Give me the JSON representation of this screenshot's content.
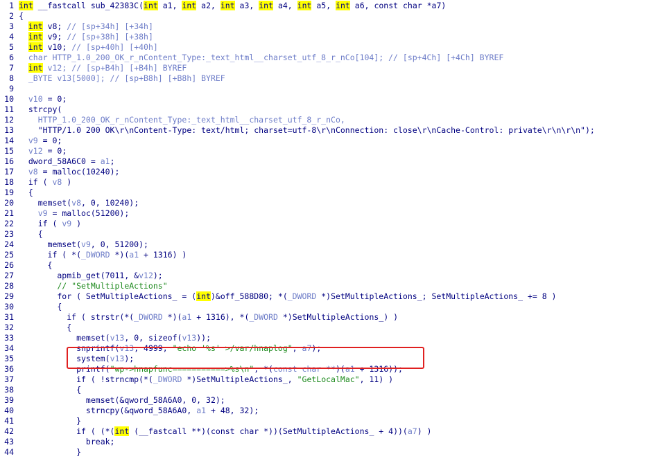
{
  "pseudocode": {
    "lines": [
      {
        "n": "1",
        "code": [
          {
            "t": "int",
            "k": "kw"
          },
          {
            "t": " __fastcall sub_42383C(",
            "k": "p"
          },
          {
            "t": "int",
            "k": "kw"
          },
          {
            "t": " a1, ",
            "k": "p"
          },
          {
            "t": "int",
            "k": "kw"
          },
          {
            "t": " a2, ",
            "k": "p"
          },
          {
            "t": "int",
            "k": "kw"
          },
          {
            "t": " a3, ",
            "k": "p"
          },
          {
            "t": "int",
            "k": "kw"
          },
          {
            "t": " a4, ",
            "k": "p"
          },
          {
            "t": "int",
            "k": "kw"
          },
          {
            "t": " a5, ",
            "k": "p"
          },
          {
            "t": "int",
            "k": "kw"
          },
          {
            "t": " a6, const char *a7)",
            "k": "p"
          }
        ]
      },
      {
        "n": "2",
        "code": [
          {
            "t": "{",
            "k": "p"
          }
        ]
      },
      {
        "n": "3",
        "code": [
          {
            "t": "  ",
            "k": "p"
          },
          {
            "t": "int",
            "k": "kw"
          },
          {
            "t": " v8; ",
            "k": "p"
          },
          {
            "t": "// [sp+34h] [+34h]",
            "k": "c"
          }
        ]
      },
      {
        "n": "4",
        "code": [
          {
            "t": "  ",
            "k": "p"
          },
          {
            "t": "int",
            "k": "kw"
          },
          {
            "t": " v9; ",
            "k": "p"
          },
          {
            "t": "// [sp+38h] [+38h]",
            "k": "c"
          }
        ]
      },
      {
        "n": "5",
        "code": [
          {
            "t": "  ",
            "k": "p"
          },
          {
            "t": "int",
            "k": "kw"
          },
          {
            "t": " v10; ",
            "k": "p"
          },
          {
            "t": "// [sp+40h] [+40h]",
            "k": "c"
          }
        ]
      },
      {
        "n": "6",
        "code": [
          {
            "t": "  char HTTP_1.0_200_OK_r_nContent_Type:_text_html__charset_utf_8_r_nCo[104]; ",
            "k": "c"
          },
          {
            "t": "// [sp+4Ch] [+4Ch] BYREF",
            "k": "c"
          }
        ]
      },
      {
        "n": "7",
        "code": [
          {
            "t": "  ",
            "k": "p"
          },
          {
            "t": "int",
            "k": "kw"
          },
          {
            "t": " v12; // [sp+B4h] [+B4h] BYREF",
            "k": "c"
          }
        ]
      },
      {
        "n": "8",
        "code": [
          {
            "t": "  _BYTE v13[5000]; // [sp+B8h] [+B8h] BYREF",
            "k": "c"
          }
        ]
      },
      {
        "n": "9",
        "code": []
      },
      {
        "n": "10",
        "code": [
          {
            "t": "  ",
            "k": "p"
          },
          {
            "t": "v10",
            "k": "v"
          },
          {
            "t": " = 0;",
            "k": "p"
          }
        ]
      },
      {
        "n": "11",
        "code": [
          {
            "t": "  strcpy(",
            "k": "p"
          }
        ]
      },
      {
        "n": "12",
        "code": [
          {
            "t": "    HTTP_1.0_200_OK_r_nContent_Type:_text_html__charset_utf_8_r_nCo,",
            "k": "v"
          }
        ]
      },
      {
        "n": "13",
        "code": [
          {
            "t": "    \"HTTP/1.0 200 OK\\r\\nContent-Type: text/html; charset=utf-8\\r\\nConnection: close\\r\\nCache-Control: private\\r\\n\\r\\n\");",
            "k": "p"
          }
        ]
      },
      {
        "n": "14",
        "code": [
          {
            "t": "  ",
            "k": "p"
          },
          {
            "t": "v9",
            "k": "v"
          },
          {
            "t": " = 0;",
            "k": "p"
          }
        ]
      },
      {
        "n": "15",
        "code": [
          {
            "t": "  ",
            "k": "p"
          },
          {
            "t": "v12",
            "k": "v"
          },
          {
            "t": " = 0;",
            "k": "p"
          }
        ]
      },
      {
        "n": "16",
        "code": [
          {
            "t": "  dword_58A6C0 = ",
            "k": "p"
          },
          {
            "t": "a1",
            "k": "v"
          },
          {
            "t": ";",
            "k": "p"
          }
        ]
      },
      {
        "n": "17",
        "code": [
          {
            "t": "  ",
            "k": "p"
          },
          {
            "t": "v8",
            "k": "v"
          },
          {
            "t": " = malloc(10240);",
            "k": "p"
          }
        ]
      },
      {
        "n": "18",
        "code": [
          {
            "t": "  if ( ",
            "k": "p"
          },
          {
            "t": "v8",
            "k": "v"
          },
          {
            "t": " )",
            "k": "p"
          }
        ]
      },
      {
        "n": "19",
        "code": [
          {
            "t": "  {",
            "k": "p"
          }
        ]
      },
      {
        "n": "20",
        "code": [
          {
            "t": "    memset(",
            "k": "p"
          },
          {
            "t": "v8",
            "k": "v"
          },
          {
            "t": ", 0, 10240);",
            "k": "p"
          }
        ]
      },
      {
        "n": "21",
        "code": [
          {
            "t": "    ",
            "k": "p"
          },
          {
            "t": "v9",
            "k": "v"
          },
          {
            "t": " = malloc(51200);",
            "k": "p"
          }
        ]
      },
      {
        "n": "22",
        "code": [
          {
            "t": "    if ( ",
            "k": "p"
          },
          {
            "t": "v9",
            "k": "v"
          },
          {
            "t": " )",
            "k": "p"
          }
        ]
      },
      {
        "n": "23",
        "code": [
          {
            "t": "    {",
            "k": "p"
          }
        ]
      },
      {
        "n": "24",
        "code": [
          {
            "t": "      memset(",
            "k": "p"
          },
          {
            "t": "v9",
            "k": "v"
          },
          {
            "t": ", 0, 51200);",
            "k": "p"
          }
        ]
      },
      {
        "n": "25",
        "code": [
          {
            "t": "      if ( *(",
            "k": "p"
          },
          {
            "t": "_DWORD",
            "k": "v"
          },
          {
            "t": " *)(",
            "k": "p"
          },
          {
            "t": "a1",
            "k": "v"
          },
          {
            "t": " + 1316) )",
            "k": "p"
          }
        ]
      },
      {
        "n": "26",
        "code": [
          {
            "t": "      {",
            "k": "p"
          }
        ]
      },
      {
        "n": "27",
        "code": [
          {
            "t": "        apmib_get(7011, &",
            "k": "p"
          },
          {
            "t": "v12",
            "k": "v"
          },
          {
            "t": ");",
            "k": "p"
          }
        ]
      },
      {
        "n": "28",
        "code": [
          {
            "t": "        // \"SetMultipleActions\"",
            "k": "s"
          }
        ]
      },
      {
        "n": "29",
        "code": [
          {
            "t": "        for ( SetMultipleActions_ = (",
            "k": "p"
          },
          {
            "t": "int",
            "k": "kw"
          },
          {
            "t": ")&off_588D80; *(",
            "k": "p"
          },
          {
            "t": "_DWORD",
            "k": "v"
          },
          {
            "t": " *)SetMultipleActions_; SetMultipleActions_ += 8 )",
            "k": "p"
          }
        ]
      },
      {
        "n": "30",
        "code": [
          {
            "t": "        {",
            "k": "p"
          }
        ]
      },
      {
        "n": "31",
        "code": [
          {
            "t": "          if ( strstr(*(",
            "k": "p"
          },
          {
            "t": "_DWORD",
            "k": "v"
          },
          {
            "t": " *)(",
            "k": "p"
          },
          {
            "t": "a1",
            "k": "v"
          },
          {
            "t": " + 1316), *(",
            "k": "p"
          },
          {
            "t": "_DWORD",
            "k": "v"
          },
          {
            "t": " *)SetMultipleActions_) )",
            "k": "p"
          }
        ]
      },
      {
        "n": "32",
        "code": [
          {
            "t": "          {",
            "k": "p"
          }
        ]
      },
      {
        "n": "33",
        "code": [
          {
            "t": "            memset(",
            "k": "p"
          },
          {
            "t": "v13",
            "k": "v"
          },
          {
            "t": ", 0, sizeof(",
            "k": "p"
          },
          {
            "t": "v13",
            "k": "v"
          },
          {
            "t": "));",
            "k": "p"
          }
        ]
      },
      {
        "n": "34",
        "code": [
          {
            "t": "            snprintf(",
            "k": "p"
          },
          {
            "t": "v13",
            "k": "v"
          },
          {
            "t": ", 4999, ",
            "k": "p"
          },
          {
            "t": "\"echo '%s' >/var/hnaplog\"",
            "k": "s"
          },
          {
            "t": ", ",
            "k": "p"
          },
          {
            "t": "a7",
            "k": "v"
          },
          {
            "t": ");",
            "k": "p"
          }
        ]
      },
      {
        "n": "35",
        "code": [
          {
            "t": "            system(",
            "k": "p"
          },
          {
            "t": "v13",
            "k": "v"
          },
          {
            "t": ");",
            "k": "p"
          }
        ]
      },
      {
        "n": "36",
        "code": [
          {
            "t": "            printf(",
            "k": "p"
          },
          {
            "t": "\"wp->hnapfunc===========>%s\\n\"",
            "k": "s"
          },
          {
            "t": ", *(",
            "k": "p"
          },
          {
            "t": "const char **",
            "k": "v"
          },
          {
            "t": ")(",
            "k": "p"
          },
          {
            "t": "a1",
            "k": "v"
          },
          {
            "t": " + 1316));",
            "k": "p"
          }
        ]
      },
      {
        "n": "37",
        "code": [
          {
            "t": "            if ( !strncmp(*(",
            "k": "p"
          },
          {
            "t": "_DWORD",
            "k": "v"
          },
          {
            "t": " *)SetMultipleActions_, ",
            "k": "p"
          },
          {
            "t": "\"GetLocalMac\"",
            "k": "s"
          },
          {
            "t": ", 11) )",
            "k": "p"
          }
        ]
      },
      {
        "n": "38",
        "code": [
          {
            "t": "            {",
            "k": "p"
          }
        ]
      },
      {
        "n": "39",
        "code": [
          {
            "t": "              memset(&qword_58A6A0, 0, 32);",
            "k": "p"
          }
        ]
      },
      {
        "n": "40",
        "code": [
          {
            "t": "              strncpy(&qword_58A6A0, ",
            "k": "p"
          },
          {
            "t": "a1",
            "k": "v"
          },
          {
            "t": " + 48, 32);",
            "k": "p"
          }
        ]
      },
      {
        "n": "41",
        "code": [
          {
            "t": "            }",
            "k": "p"
          }
        ]
      },
      {
        "n": "42",
        "code": [
          {
            "t": "            if ( (*(",
            "k": "p"
          },
          {
            "t": "int",
            "k": "kw"
          },
          {
            "t": " (__fastcall **)(const char *))(SetMultipleActions_ + 4))(",
            "k": "p"
          },
          {
            "t": "a7",
            "k": "v"
          },
          {
            "t": ") )",
            "k": "p"
          }
        ]
      },
      {
        "n": "43",
        "code": [
          {
            "t": "              break;",
            "k": "p"
          }
        ]
      },
      {
        "n": "44",
        "code": [
          {
            "t": "            }",
            "k": "p"
          }
        ]
      }
    ]
  }
}
